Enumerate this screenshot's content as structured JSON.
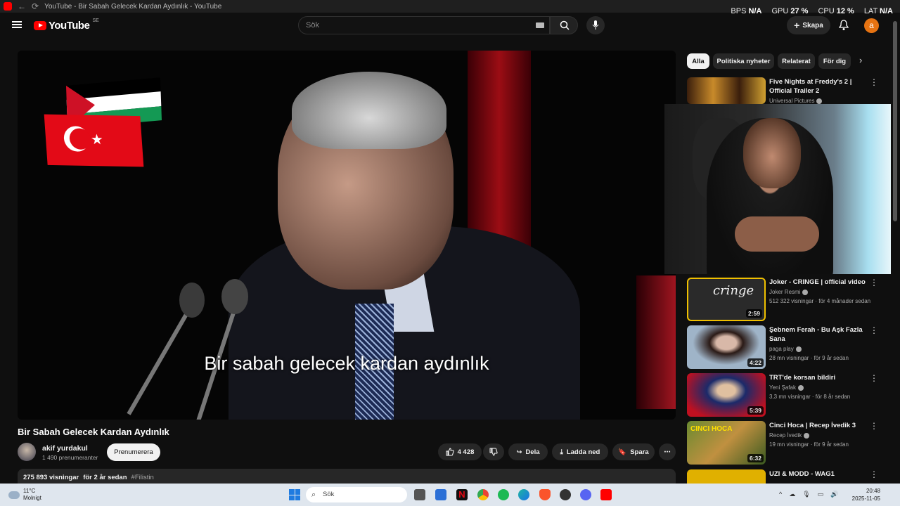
{
  "browser": {
    "tab_title": "YouTube - Bir Sabah Gelecek Kardan Aydınlık - YouTube",
    "back_icon": "←",
    "reload_icon": "⟳"
  },
  "overlay_stats": {
    "bps_label": "BPS",
    "bps_value": "N/A",
    "gpu_label": "GPU",
    "gpu_value": "27 %",
    "cpu_label": "CPU",
    "cpu_value": "12 %",
    "lat_label": "LAT",
    "lat_value": "N/A"
  },
  "masthead": {
    "logo_text": "YouTube",
    "country_code": "SE",
    "search_placeholder": "Sök",
    "create_label": "Skapa",
    "avatar_letter": "a",
    "accent_color": "#ff0000"
  },
  "video": {
    "subtitle_text": "Bir sabah gelecek kardan aydınlık",
    "title": "Bir Sabah Gelecek Kardan Aydınlık",
    "channel_name": "akif yurdakul",
    "subscribers": "1 490 prenumeranter",
    "subscribe_label": "Prenumerera",
    "likes": "4 428",
    "share_label": "Dela",
    "download_label": "Ladda ned",
    "save_label": "Spara",
    "views": "275 893 visningar",
    "age": "för 2 år sedan",
    "hashtag": "#Filistin"
  },
  "chips": [
    "Alla",
    "Politiska nyheter",
    "Relaterat",
    "För dig"
  ],
  "recommendations": [
    {
      "title": "Five Nights at Freddy's 2 | Official Trailer 2",
      "channel": "Universal Pictures",
      "meta": ""
    },
    {
      "title": "Joker - CRINGE | official video",
      "channel": "Joker Resmi",
      "meta": "512 322 visningar · för 4 månader sedan",
      "duration": "2:59",
      "thumb_text": "cringe"
    },
    {
      "title": "Şebnem Ferah - Bu Aşk Fazla Sana",
      "channel": "paga play",
      "meta": "28 mn visningar · för 9 år sedan",
      "duration": "4:22"
    },
    {
      "title": "TRT'de korsan bildiri",
      "channel": "Yeni Şafak",
      "meta": "3,3 mn visningar · för 8 år sedan",
      "duration": "5:39"
    },
    {
      "title": "Cinci Hoca | Recep İvedik 3",
      "channel": "Recep İvedik",
      "meta": "19 mn visningar · för 9 år sedan",
      "duration": "6:32",
      "thumb_text": "CINCI HOCA"
    },
    {
      "title": "UZI & MODD - WAG1",
      "channel": "",
      "meta": ""
    }
  ],
  "taskbar": {
    "weather_temp": "11°C",
    "weather_desc": "Molnigt",
    "search_label": "Sök",
    "time": "20:48",
    "date": "2025-11-05"
  }
}
